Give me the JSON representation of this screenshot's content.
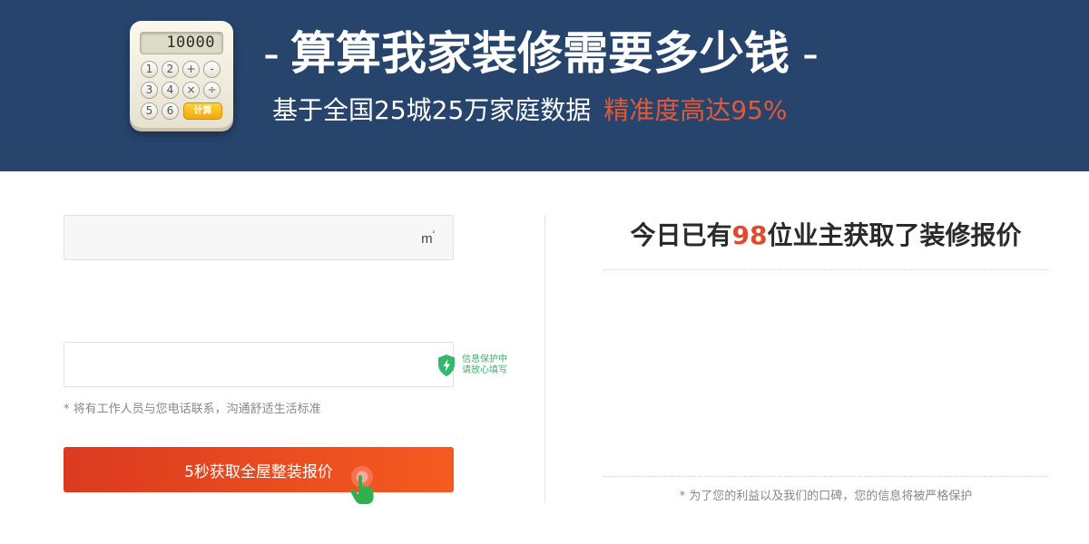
{
  "banner": {
    "background_color": "#27446c",
    "calculator": {
      "display_value": "10000",
      "keys": [
        "1",
        "2",
        "+",
        "-",
        "3",
        "4",
        "×",
        "÷",
        "5",
        "6"
      ],
      "equals_label": "计算"
    },
    "title": "算算我家装修需要多少钱",
    "title_dash": "-",
    "subtitle": "基于全国25城25万家庭数据",
    "subtitle_highlight": "精准度高达95%",
    "highlight_color": "#e05a3a"
  },
  "form": {
    "area_input": {
      "value": "",
      "placeholder": "",
      "unit": "m",
      "unit_sup": "²"
    },
    "phone_input": {
      "value": "",
      "placeholder": ""
    },
    "secure_badge": {
      "line1": "信息保护中",
      "line2": "请放心填写",
      "color": "#34b66d"
    },
    "tip": "* 将有工作人员与您电话联系，沟通舒适生活标准",
    "submit_label": "5秒获取全屋整装报价",
    "submit_color": "#f05020"
  },
  "right_panel": {
    "headline_prefix": "今日已有",
    "headline_count": "98",
    "headline_suffix": "位业主获取了装修报价",
    "count_color": "#e04b2c",
    "privacy_note": "* 为了您的利益以及我们的口碑，您的信息将被严格保护"
  },
  "icons": {
    "calculator": "calculator-icon",
    "shield": "shield-bolt-icon",
    "pointer": "hand-pointer-icon"
  }
}
